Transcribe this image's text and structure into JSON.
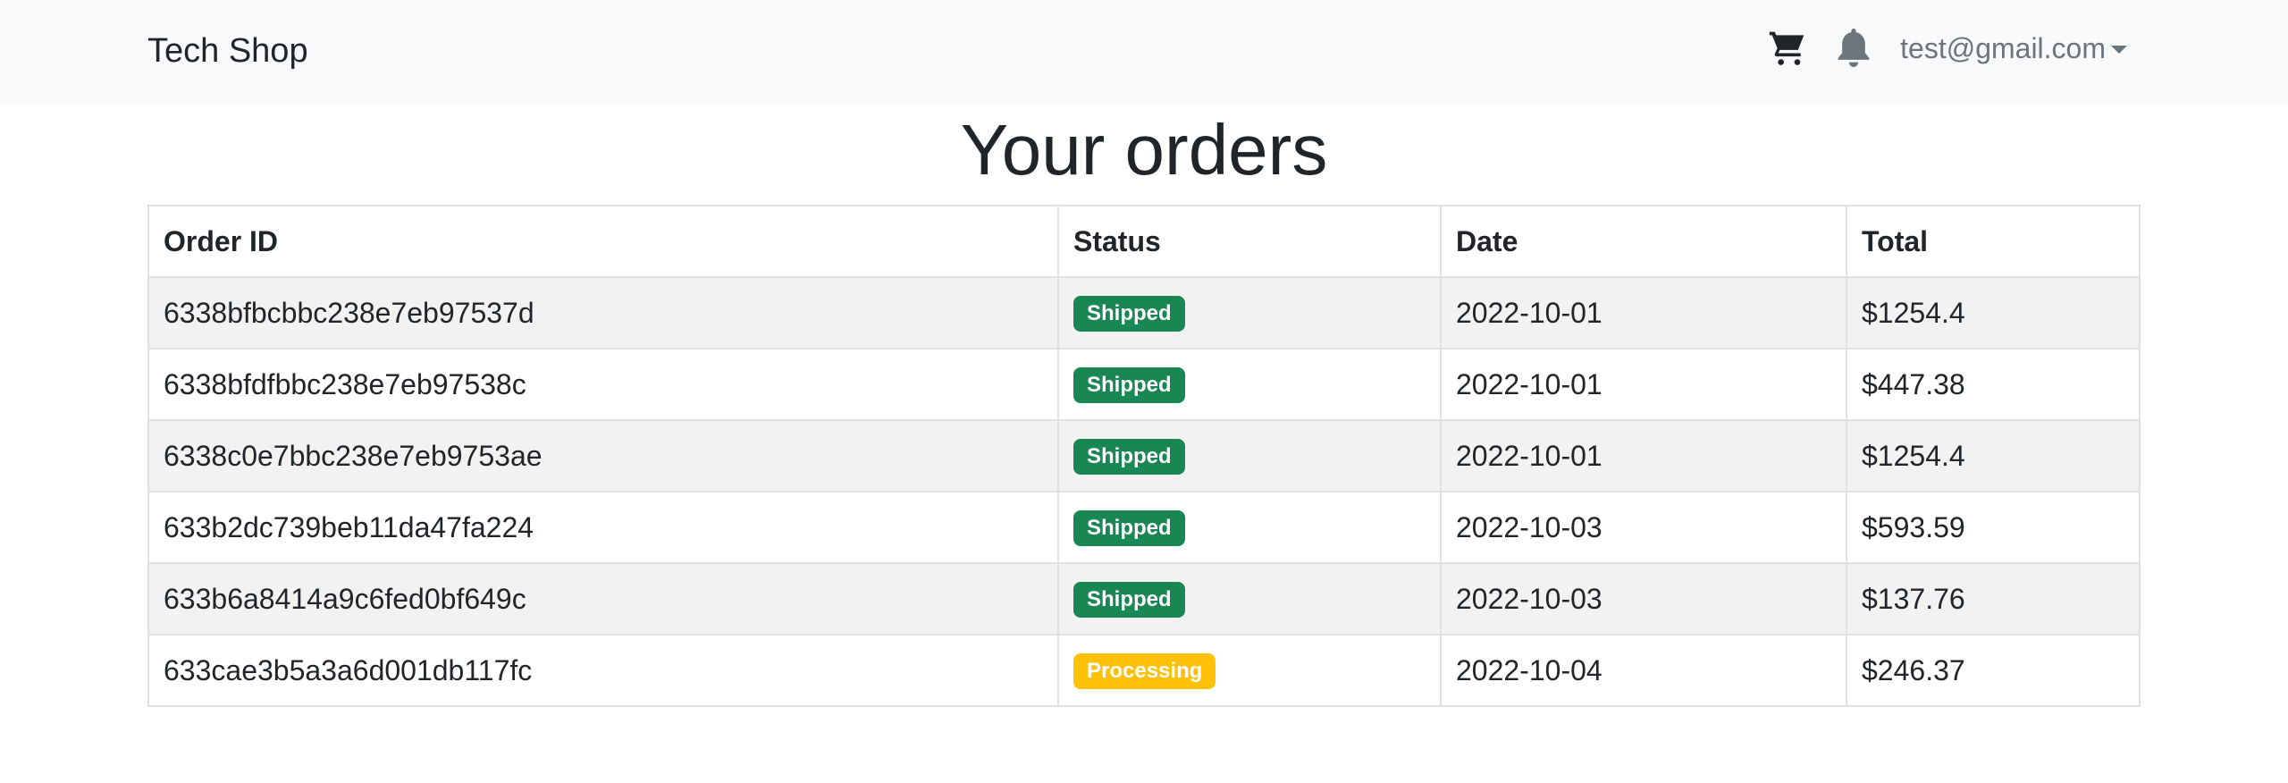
{
  "navbar": {
    "brand": "Tech Shop",
    "cart_icon": "cart-icon",
    "bell_icon": "bell-icon",
    "user_email": "test@gmail.com"
  },
  "page": {
    "title": "Your orders"
  },
  "table": {
    "headers": {
      "order_id": "Order ID",
      "status": "Status",
      "date": "Date",
      "total": "Total"
    },
    "rows": [
      {
        "order_id": "6338bfbcbbc238e7eb97537d",
        "status": "Shipped",
        "date": "2022-10-01",
        "total": "$1254.4"
      },
      {
        "order_id": "6338bfdfbbc238e7eb97538c",
        "status": "Shipped",
        "date": "2022-10-01",
        "total": "$447.38"
      },
      {
        "order_id": "6338c0e7bbc238e7eb9753ae",
        "status": "Shipped",
        "date": "2022-10-01",
        "total": "$1254.4"
      },
      {
        "order_id": "633b2dc739beb11da47fa224",
        "status": "Shipped",
        "date": "2022-10-03",
        "total": "$593.59"
      },
      {
        "order_id": "633b6a8414a9c6fed0bf649c",
        "status": "Shipped",
        "date": "2022-10-03",
        "total": "$137.76"
      },
      {
        "order_id": "633cae3b5a3a6d001db117fc",
        "status": "Processing",
        "date": "2022-10-04",
        "total": "$246.37"
      }
    ]
  },
  "colors": {
    "shipped": "#198754",
    "processing": "#ffc107",
    "navbar_bg": "#f8f9fa"
  }
}
